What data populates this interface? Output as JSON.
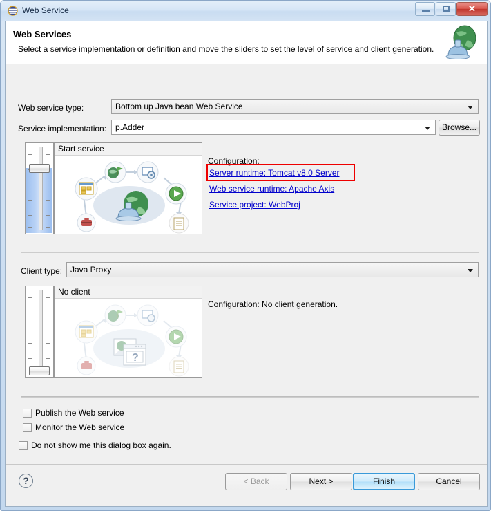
{
  "window": {
    "title": "Web Service",
    "icon": "eclipse-globe-icon",
    "minimize_label": "",
    "maximize_label": "",
    "close_label": "✕"
  },
  "header": {
    "title": "Web Services",
    "description": "Select a service implementation or definition and move the sliders to set the level of service and client generation.",
    "icon": "web-service-globe-icon"
  },
  "form": {
    "web_service_type_label": "Web service type:",
    "web_service_type_value": "Bottom up Java bean Web Service",
    "service_implementation_label": "Service implementation:",
    "service_implementation_value": "p.Adder",
    "browse_label": "Browse..."
  },
  "service_panel": {
    "stage_label": "Start service",
    "slider_name": "service-level-slider",
    "slider_position": "start-service",
    "configuration_title": "Configuration:",
    "links": [
      {
        "label": "Server runtime: Tomcat v8.0 Server",
        "highlighted": true
      },
      {
        "label": "Web service runtime: Apache Axis",
        "highlighted": false
      },
      {
        "label": "Service project: WebProj",
        "highlighted": false
      }
    ],
    "highlight_color": "#ee0000",
    "link_color": "#0000cc"
  },
  "client_panel": {
    "client_type_label": "Client type:",
    "client_type_value": "Java Proxy",
    "stage_label": "No client",
    "slider_name": "client-level-slider",
    "slider_position": "no-client",
    "configuration_text": "Configuration: No client generation."
  },
  "options": [
    {
      "label": "Publish the Web service",
      "checked": false
    },
    {
      "label": "Monitor the Web service",
      "checked": false
    },
    {
      "label": "Do not show me this dialog box again.",
      "checked": false
    }
  ],
  "buttons": {
    "help": "?",
    "back": "< Back",
    "next": "Next >",
    "finish": "Finish",
    "cancel": "Cancel"
  }
}
